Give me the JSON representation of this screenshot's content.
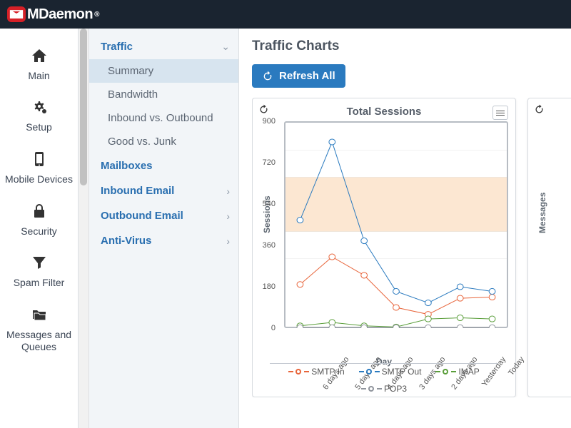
{
  "brand": {
    "name": "MDaemon",
    "reg": "®"
  },
  "nav": [
    {
      "k": "main",
      "label": "Main",
      "icon": "home"
    },
    {
      "k": "setup",
      "label": "Setup",
      "icon": "cogs"
    },
    {
      "k": "mobile",
      "label": "Mobile Devices",
      "icon": "phone"
    },
    {
      "k": "security",
      "label": "Security",
      "icon": "lock"
    },
    {
      "k": "spam",
      "label": "Spam Filter",
      "icon": "filter"
    },
    {
      "k": "queues",
      "label": "Messages and Queues",
      "icon": "folder"
    }
  ],
  "sub": {
    "traffic": {
      "label": "Traffic",
      "open": true,
      "children": [
        {
          "k": "summary",
          "label": "Summary",
          "active": true
        },
        {
          "k": "bandwidth",
          "label": "Bandwidth"
        },
        {
          "k": "io",
          "label": "Inbound vs. Outbound"
        },
        {
          "k": "gj",
          "label": "Good vs. Junk"
        }
      ]
    },
    "mailboxes": {
      "label": "Mailboxes"
    },
    "inbound": {
      "label": "Inbound Email",
      "chev": true
    },
    "outbound": {
      "label": "Outbound Email",
      "chev": true
    },
    "antivirus": {
      "label": "Anti-Virus",
      "chev": true
    }
  },
  "page": {
    "title": "Traffic Charts",
    "refresh": "Refresh All"
  },
  "chart_data": [
    {
      "type": "line",
      "title": "Total Sessions",
      "xlabel": "Day",
      "ylabel": "Sessions",
      "ylim": [
        0,
        900
      ],
      "yticks": [
        0,
        180,
        360,
        540,
        720,
        900
      ],
      "categories": [
        "6 days ago",
        "5 days ago",
        "4 days ago",
        "3 days ago",
        "2 days ago",
        "Yesterday",
        "Today"
      ],
      "series": [
        {
          "name": "SMTP In",
          "color": "#e8653b",
          "values": [
            190,
            310,
            230,
            90,
            60,
            130,
            135
          ]
        },
        {
          "name": "SMTP Out",
          "color": "#2a7abf",
          "values": [
            470,
            810,
            380,
            160,
            110,
            180,
            160
          ]
        },
        {
          "name": "IMAP",
          "color": "#5a9e3a",
          "values": [
            10,
            25,
            10,
            5,
            40,
            45,
            40
          ]
        },
        {
          "name": "POP3",
          "color": "#8f949c",
          "values": [
            2,
            2,
            2,
            2,
            2,
            2,
            2
          ]
        }
      ]
    },
    {
      "type": "line",
      "title": "",
      "ylabel": "Messages"
    }
  ]
}
